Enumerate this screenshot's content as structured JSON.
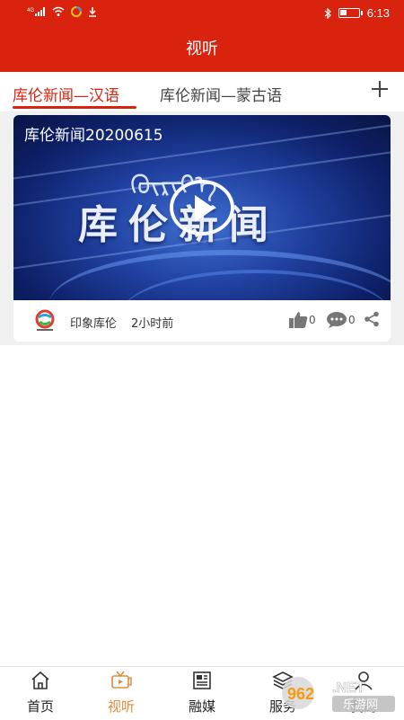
{
  "status_bar": {
    "time": "6:13",
    "icons": [
      "signal-icon",
      "wifi-icon",
      "app-notification-icon",
      "download-icon",
      "bluetooth-icon",
      "battery-icon"
    ],
    "battery_level": 0.35
  },
  "header": {
    "title": "视听"
  },
  "tabs": [
    {
      "label": "库伦新闻—汉语",
      "active": true
    },
    {
      "label": "库伦新闻—蒙古语",
      "active": false
    }
  ],
  "tab_add_icon": "plus-icon",
  "video_card": {
    "title": "库伦新闻20200615",
    "thumbnail_logo": "库伦新闻",
    "thumbnail_mongolian": "ᠬᠦᠷᠢᠶ᠎ᠡ",
    "source": "印象库伦",
    "time_ago": "2小时前",
    "likes": "0",
    "comments": "0"
  },
  "bottom_nav": [
    {
      "label": "首页",
      "icon": "home-icon",
      "active": false
    },
    {
      "label": "视听",
      "icon": "tv-icon",
      "active": true
    },
    {
      "label": "融媒",
      "icon": "newspaper-icon",
      "active": false
    },
    {
      "label": "服务",
      "icon": "layers-icon",
      "active": false
    },
    {
      "label": "我的",
      "icon": "user-icon",
      "active": false
    }
  ],
  "watermark": {
    "text": "962.NET",
    "subtext": "乐游网"
  },
  "colors": {
    "brand_red": "#d9230f",
    "active_nav": "#e08a3c"
  }
}
